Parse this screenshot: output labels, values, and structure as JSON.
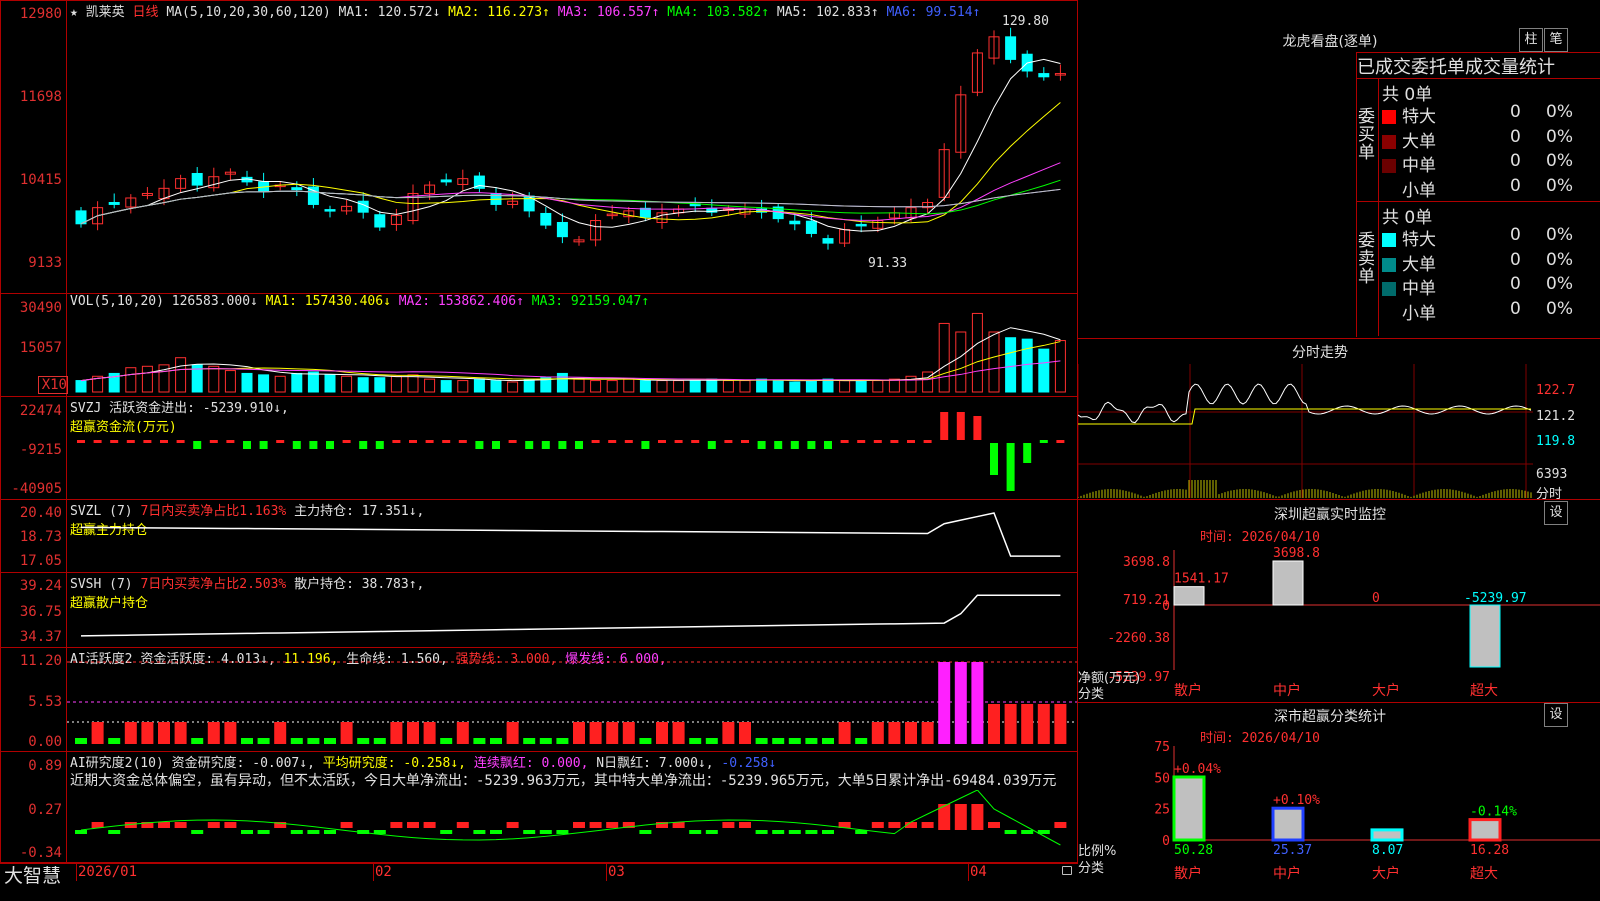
{
  "stock": {
    "name": "凯莱英",
    "period": "日线",
    "star": "★"
  },
  "ma_header": {
    "prefix": "MA(5,10,20,30,60,120)",
    "ma1": "MA1: 120.572↓",
    "ma2": "MA2: 116.273↑",
    "ma3": "MA3: 106.557↑",
    "ma4": "MA4: 103.582↑",
    "ma5": "MA5: 102.833↑",
    "ma6": "MA6: 99.514↑"
  },
  "price_axis": [
    "12980",
    "11698",
    "10415",
    "9133"
  ],
  "price_marks": {
    "high": "129.80",
    "low": "91.33"
  },
  "vol_header": {
    "prefix": "VOL(5,10,20)",
    "val": "126583.000↓",
    "ma1": "MA1: 157430.406↓",
    "ma2": "MA2: 153862.406↑",
    "ma3": "MA3: 92159.047↑"
  },
  "vol_axis": [
    "30490",
    "15057",
    "X10"
  ],
  "svzj_header": {
    "line1": "SVZJ  活跃资金进出: -5239.910↓,",
    "line2": "超赢资金流(万元)"
  },
  "svzj_axis": [
    "22474",
    "-9215",
    "-40905"
  ],
  "svzl_header": {
    "prefix": "SVZL (7)",
    "a": "7日内买卖净占比1.163%",
    "b": "主力持仓: 17.351↓,",
    "line2": "超赢主力持仓"
  },
  "svzl_axis": [
    "20.40",
    "18.73",
    "17.05"
  ],
  "svsh_header": {
    "prefix": "SVSH (7)",
    "a": "7日内买卖净占比2.503%",
    "b": "散户持仓: 38.783↑,",
    "line2": "超赢散户持仓"
  },
  "svsh_axis": [
    "39.24",
    "36.75",
    "34.37"
  ],
  "ai1_header": {
    "prefix": "AI活跃度2",
    "a": "资金活跃度: 4.013↓,",
    "b": "11.196,",
    "c": "生命线: 1.560,",
    "d": "强势线: 3.000,",
    "e": "爆发线: 6.000,"
  },
  "ai1_axis": [
    "11.20",
    "5.53",
    "0.00"
  ],
  "ai2_header": {
    "prefix": "AI研究度2(10)",
    "a": "资金研究度: -0.007↓,",
    "b": "平均研究度: -0.258↓,",
    "c": "连续飘红: 0.000,",
    "d": "N日飘红: 7.000↓,",
    "e": "-0.258↓"
  },
  "ai2_text": "近期大资金总体偏空，虽有异动，但不太活跃，今日大单净流出：-5239.963万元，其中特大单净流出：-5239.965万元，大单5日累计净出-69484.039万元",
  "ai2_axis": [
    "0.89",
    "0.27",
    "-0.34"
  ],
  "x_axis": [
    "2026/01",
    "02",
    "03",
    "04"
  ],
  "brand": "大智慧",
  "right": {
    "lhb_title": "龙虎看盘(逐单)",
    "btn_zhu": "柱",
    "btn_bi": "笔",
    "tabs": [
      "已成交",
      "委托单",
      "成交量统计"
    ],
    "buy_label": "委买单",
    "sell_label": "委卖单",
    "buy_total": "共 0单",
    "sell_total": "共 0单",
    "buy_rows": [
      {
        "name": "特大",
        "n": "0",
        "p": "0%",
        "color": "#ff0000"
      },
      {
        "name": "大单",
        "n": "0",
        "p": "0%",
        "color": "#8b0000"
      },
      {
        "name": "中单",
        "n": "0",
        "p": "0%",
        "color": "#6b0000"
      },
      {
        "name": "小单",
        "n": "0",
        "p": "0%",
        "color": "#000000"
      }
    ],
    "sell_rows": [
      {
        "name": "特大",
        "n": "0",
        "p": "0%",
        "color": "#00ffff"
      },
      {
        "name": "大单",
        "n": "0",
        "p": "0%",
        "color": "#008b8b"
      },
      {
        "name": "中单",
        "n": "0",
        "p": "0%",
        "color": "#006b6b"
      },
      {
        "name": "小单",
        "n": "0",
        "p": "0%",
        "color": "#000000"
      }
    ],
    "fs_title": "分时走势",
    "fs_axis": [
      "122.7",
      "121.2",
      "119.8",
      "6393"
    ],
    "fs_unit": "分时",
    "sz_title": "深圳超赢实时监控",
    "sz_btn": "设",
    "sz_time": "时间: 2026/04/10",
    "sz_axis": [
      "3698.8",
      "719.21",
      "0",
      "-2260.38",
      "-5239.97"
    ],
    "sz_ylabel": "净额(万元)",
    "sz_xlabel": "分类",
    "ss_title": "深市超赢分类统计",
    "ss_btn": "设",
    "ss_time": "时间: 2026/04/10",
    "ss_axis": [
      "75",
      "50",
      "25",
      "0"
    ],
    "ss_ylabel": "比例%",
    "ss_xlabel": "分类"
  },
  "chart_data": [
    {
      "type": "bar",
      "title": "深圳超赢实时监控",
      "ylabel": "净额(万元)",
      "xlabel": "分类",
      "categories": [
        "散户",
        "中户",
        "大户",
        "超大"
      ],
      "values": [
        1541.17,
        3698.8,
        0,
        -5239.97
      ],
      "labels": [
        "1541.17",
        "3698.8",
        "0",
        "-5239.97"
      ],
      "ylim": [
        -5239.97,
        3698.8
      ]
    },
    {
      "type": "bar",
      "title": "深市超赢分类统计",
      "ylabel": "比例%",
      "xlabel": "分类",
      "categories": [
        "散户",
        "中户",
        "大户",
        "超大"
      ],
      "values": [
        50.28,
        25.37,
        8.07,
        16.28
      ],
      "changes": [
        "+0.04%",
        "+0.10%",
        "",
        "-0.14%"
      ],
      "ylim": [
        0,
        75
      ]
    },
    {
      "type": "candlestick",
      "title": "凯莱英 日线",
      "x": [
        "2026/01",
        "02",
        "03",
        "04"
      ],
      "ylim": [
        91.33,
        129.8
      ],
      "close": [
        98.5,
        101,
        101.5,
        102.5,
        103.2,
        104,
        105.5,
        104.5,
        105.8,
        106.5,
        105,
        103.5,
        104.5,
        103.8,
        101.5,
        100.5,
        101.2,
        100.3,
        98,
        99.8,
        103.2,
        104.5,
        105,
        105.5,
        104,
        101.5,
        102,
        100.5,
        98.3,
        96.5,
        96,
        99,
        100,
        100.5,
        99.5,
        100.2,
        100.8,
        101.3,
        100.3,
        100.8,
        100.8,
        100.3,
        99.3,
        98.5,
        97,
        95.5,
        97.6,
        98.2,
        99,
        100.2,
        101,
        101.8,
        110,
        118.5,
        125,
        127.5,
        124,
        122.2,
        121.3,
        121.8
      ],
      "volume_x10": [
        800,
        1100,
        1300,
        1700,
        1800,
        1900,
        2400,
        1900,
        1800,
        1500,
        1300,
        1200,
        1100,
        1300,
        1400,
        1200,
        1100,
        1000,
        1000,
        1100,
        1200,
        900,
        800,
        800,
        900,
        800,
        700,
        900,
        1000,
        1300,
        900,
        800,
        800,
        900,
        800,
        800,
        800,
        800,
        900,
        800,
        800,
        900,
        800,
        700,
        800,
        900,
        800,
        800,
        800,
        900,
        1100,
        1400,
        4800,
        4200,
        5500,
        4200,
        3800,
        3700,
        3000,
        3600
      ]
    }
  ]
}
